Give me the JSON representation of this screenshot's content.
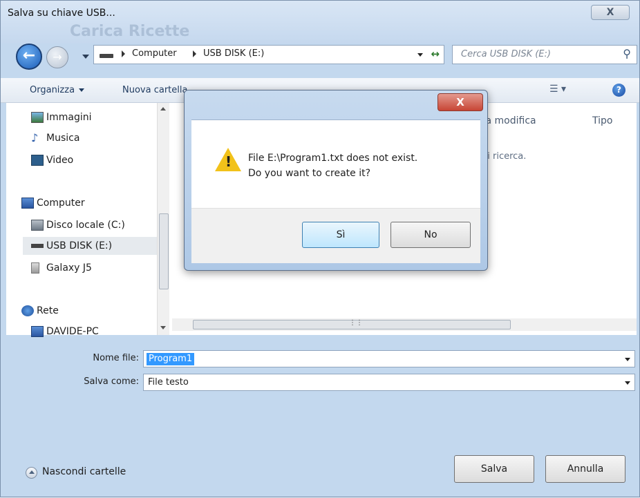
{
  "window": {
    "title": "Salva su chiave USB...",
    "background_title": "Carica Ricette",
    "close_glyph": "X"
  },
  "nav": {
    "back_icon": "back-arrow-icon",
    "forward_icon": "forward-arrow-icon",
    "breadcrumb": [
      "Computer",
      "USB DISK (E:)"
    ],
    "search_placeholder": "Cerca USB DISK (E:)",
    "refresh_glyph": "↔"
  },
  "toolbar": {
    "organize": "Organizza",
    "new_folder": "Nuova cartella",
    "help_glyph": "?"
  },
  "sidebar": {
    "items": [
      {
        "label": "Immagini",
        "icon": "pictures-icon"
      },
      {
        "label": "Musica",
        "icon": "music-icon"
      },
      {
        "label": "Video",
        "icon": "video-icon"
      },
      {
        "label": "Computer",
        "icon": "computer-icon"
      },
      {
        "label": "Disco locale (C:)",
        "icon": "local-disk-icon"
      },
      {
        "label": "USB DISK (E:)",
        "icon": "usb-drive-icon",
        "selected": true
      },
      {
        "label": "Galaxy J5",
        "icon": "phone-icon"
      },
      {
        "label": "Rete",
        "icon": "network-icon"
      },
      {
        "label": "DAVIDE-PC",
        "icon": "pc-icon"
      }
    ]
  },
  "file_list": {
    "columns": [
      "ta modifica",
      "Tipo"
    ],
    "empty_text": "di ricerca."
  },
  "form": {
    "filename_label": "Nome file:",
    "filename_value": "Program1",
    "savetype_label": "Salva come:",
    "savetype_value": "File testo"
  },
  "footer": {
    "hide_folders": "Nascondi cartelle",
    "save": "Salva",
    "cancel": "Annulla"
  },
  "modal": {
    "close_glyph": "X",
    "message_line1": "File E:\\Program1.txt does not exist.",
    "message_line2": "Do you want to create it?",
    "yes": "Sì",
    "no": "No"
  },
  "colors": {
    "selection": "#3399ff",
    "warning": "#f2c21a",
    "close_red": "#c74535"
  }
}
